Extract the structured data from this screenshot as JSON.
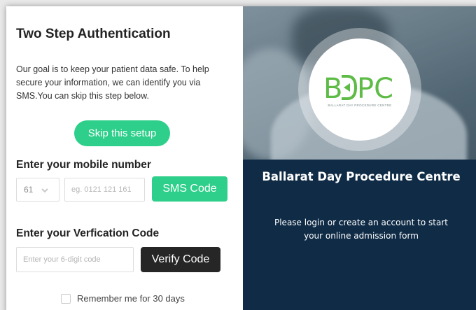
{
  "left": {
    "title": "Two Step Authentication",
    "intro": "Our goal is to keep your patient data safe. To help secure your information, we can identify you via SMS.You can skip this step below.",
    "skip_label": "Skip this setup",
    "mobile_heading": "Enter your mobile number",
    "country_code": "61",
    "phone_placeholder": "eg. 0121 121 161",
    "sms_label": "SMS Code",
    "verify_heading": "Enter your Verfication Code",
    "code_placeholder": "Enter your 6-digit code",
    "verify_label": "Verify Code",
    "remember_label": "Remember me for 30 days"
  },
  "right": {
    "logo_text": "BDPC",
    "logo_subtext": "BALLARAT DAY PROCEDURE CENTRE",
    "org_name": "Ballarat Day Procedure Centre",
    "message": "Please login or create an account to start your online admission form"
  },
  "colors": {
    "accent_green": "#2dcf8a",
    "dark_button": "#262626",
    "navy_panel": "#0f2b46"
  },
  "icons": [
    "chevron-down-icon",
    "checkbox-icon",
    "bdpc-logo"
  ]
}
